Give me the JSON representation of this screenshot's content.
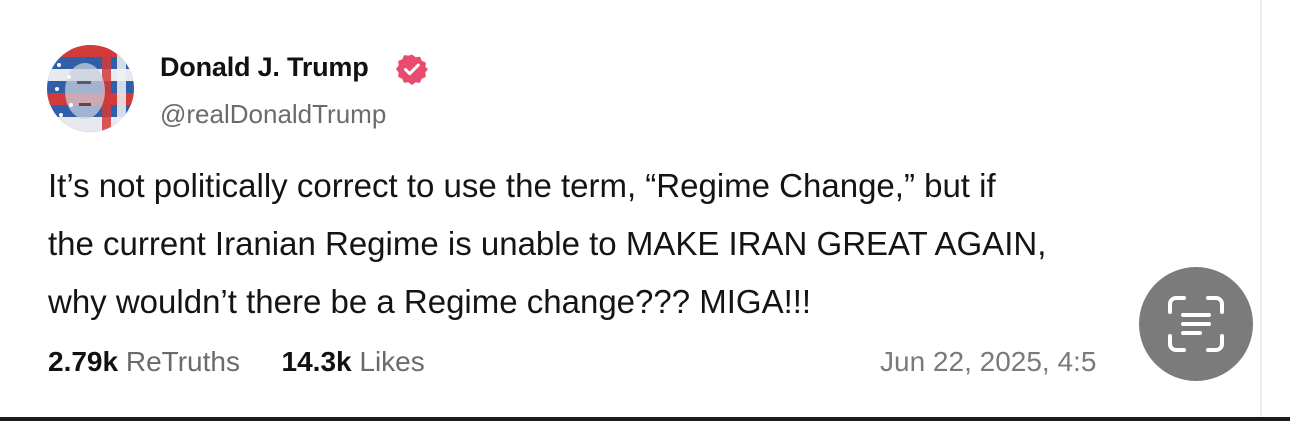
{
  "post": {
    "author": {
      "display_name": "Donald J. Trump",
      "handle": "@realDonaldTrump",
      "verified_icon": "verified-badge-icon",
      "verified_color": "#e94b6f"
    },
    "text_lines": [
      "It’s not politically correct to use the term, “Regime Change,” but if",
      "the current Iranian Regime is unable to MAKE IRAN GREAT AGAIN,",
      "why wouldn’t there be a Regime change??? MIGA!!!"
    ],
    "stats": {
      "retruths_count": "2.79k",
      "retruths_label": "ReTruths",
      "likes_count": "14.3k",
      "likes_label": "Likes"
    },
    "timestamp": "Jun 22, 2025, 4:5"
  },
  "overlay": {
    "scan_button_icon": "live-text-scan-icon"
  }
}
